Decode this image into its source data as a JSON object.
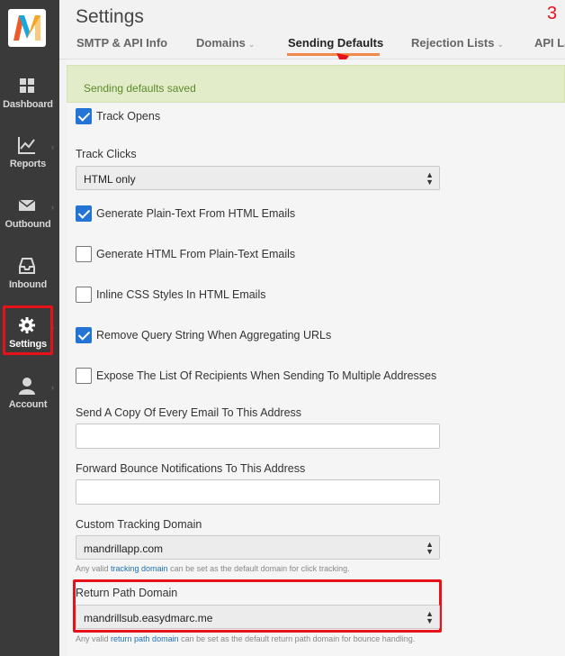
{
  "app": {
    "logo_letter": "M"
  },
  "sidebar": {
    "items": [
      {
        "label": "Dashboard",
        "icon": "grid-icon"
      },
      {
        "label": "Reports",
        "icon": "chart-icon"
      },
      {
        "label": "Outbound",
        "icon": "envelope-icon"
      },
      {
        "label": "Inbound",
        "icon": "inbox-tray-icon"
      },
      {
        "label": "Settings",
        "icon": "gear-icon"
      },
      {
        "label": "Account",
        "icon": "user-icon"
      }
    ]
  },
  "header": {
    "title": "Settings",
    "step": "3",
    "tabs": [
      {
        "label": "SMTP & API Info"
      },
      {
        "label": "Domains"
      },
      {
        "label": "Sending Defaults"
      },
      {
        "label": "Rejection Lists"
      },
      {
        "label": "API La"
      }
    ]
  },
  "alert": {
    "text": "Sending defaults saved"
  },
  "form": {
    "track_opens": {
      "label": "Track Opens",
      "checked": true
    },
    "track_clicks": {
      "label": "Track Clicks",
      "value": "HTML only"
    },
    "gen_plain": {
      "label": "Generate Plain-Text From HTML Emails",
      "checked": true
    },
    "gen_html": {
      "label": "Generate HTML From Plain-Text Emails",
      "checked": false
    },
    "inline_css": {
      "label": "Inline CSS Styles In HTML Emails",
      "checked": false
    },
    "remove_query": {
      "label": "Remove Query String When Aggregating URLs",
      "checked": true
    },
    "expose_list": {
      "label": "Expose The List Of Recipients When Sending To Multiple Addresses",
      "checked": false
    },
    "bcc": {
      "label": "Send A Copy Of Every Email To This Address",
      "value": ""
    },
    "bounce": {
      "label": "Forward Bounce Notifications To This Address",
      "value": ""
    },
    "tracking_domain": {
      "label": "Custom Tracking Domain",
      "value": "mandrillapp.com",
      "help_pre": "Any valid ",
      "help_link": "tracking domain",
      "help_post": " can be set as the default domain for click tracking."
    },
    "return_path": {
      "label": "Return Path Domain",
      "value": "mandrillsub.easydmarc.me",
      "help_pre": "Any valid ",
      "help_link": "return path domain",
      "help_post": " can be set as the default return path domain for bounce handling."
    }
  },
  "colors": {
    "accent": "#f0894a",
    "highlight": "#e8111a",
    "checkbox": "#2474d6",
    "sidebar": "#3a3a3a"
  }
}
